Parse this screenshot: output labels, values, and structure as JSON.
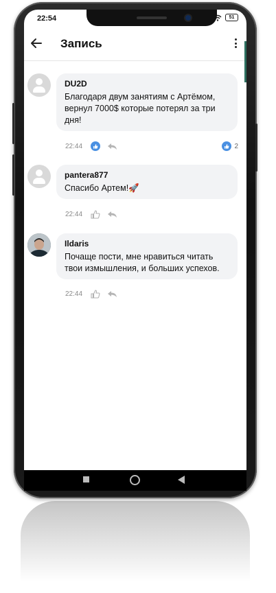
{
  "status": {
    "time": "22:54",
    "battery": "51"
  },
  "appbar": {
    "title": "Запись"
  },
  "comments": [
    {
      "author": "DU2D",
      "text": "Благодаря двум занятиям с Артёмом, вернул 7000$ которые потерял за три дня!",
      "time": "22:44",
      "like_count": "2",
      "liked": true
    },
    {
      "author": "pantera877",
      "text": "Спасибо Артем!🚀",
      "time": "22:44",
      "liked": false
    },
    {
      "author": "Ildaris",
      "text": "Почаще пости, мне нравиться читать твои измышления, и больших успехов.",
      "time": "22:44",
      "liked": false
    }
  ],
  "colors": {
    "like_blue": "#4a90e2",
    "bubble": "#f2f3f5",
    "accent_green": "#2d6f5f"
  },
  "icons": [
    "back-arrow-icon",
    "more-vert-icon",
    "like-icon",
    "reply-icon",
    "user-placeholder-icon"
  ]
}
